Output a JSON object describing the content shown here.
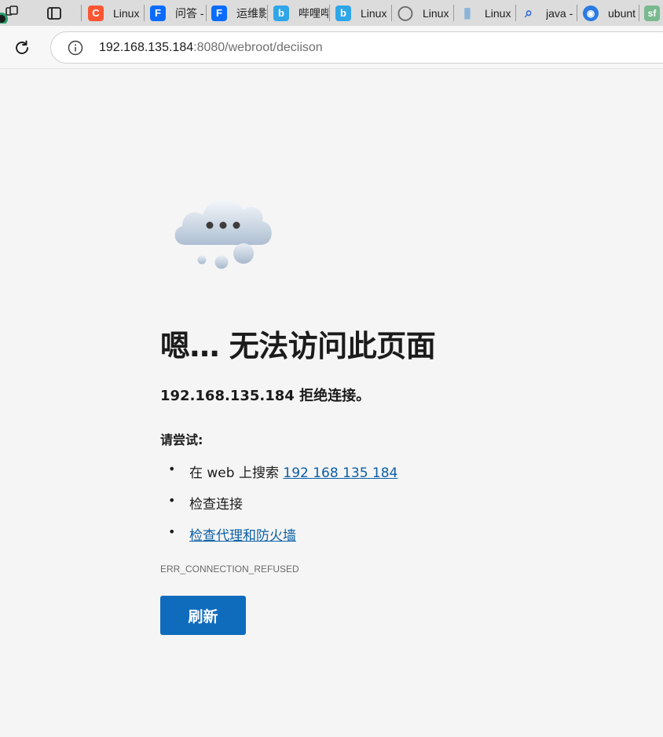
{
  "browser": {
    "tabs": [
      {
        "title": "Linux",
        "icon": "csdn-icon",
        "color": "#fc5531",
        "glyph": "C"
      },
      {
        "title": "问答 -",
        "icon": "tencent-cloud-icon",
        "color": "#0a6cff",
        "glyph": "F"
      },
      {
        "title": "运维影",
        "icon": "tencent-cloud-icon",
        "color": "#0a6cff",
        "glyph": "F"
      },
      {
        "title": "哔哩哔",
        "icon": "bilibili-icon",
        "color": "#2fa6e8",
        "glyph": "b"
      },
      {
        "title": "Linux",
        "icon": "bilibili-icon",
        "color": "#2fa6e8",
        "glyph": "b"
      },
      {
        "title": "Linux",
        "icon": "globe-icon",
        "color": "#7a7a7a",
        "glyph": "◯"
      },
      {
        "title": "Linux",
        "icon": "site-icon",
        "color": "#8ab4d8",
        "glyph": "▮"
      },
      {
        "title": "java -",
        "icon": "search-icon",
        "color": "#3b6fd6",
        "glyph": "⌕"
      },
      {
        "title": "ubunt",
        "icon": "ubuntu-icon",
        "color": "#2a7ae2",
        "glyph": "◉"
      },
      {
        "title": "",
        "icon": "segmentfault-icon",
        "color": "#7ab98f",
        "glyph": "sf"
      }
    ],
    "address": {
      "host": "192.168.135.184",
      "path": ":8080/webroot/deciison"
    }
  },
  "error_page": {
    "heading": "嗯… 无法访问此页面",
    "subheading": "192.168.135.184 拒绝连接。",
    "try_label": "请尝试:",
    "suggestions": {
      "search_prefix": "在 web 上搜索 ",
      "search_link": "192 168 135 184",
      "check_connection": "检查连接",
      "check_proxy": "检查代理和防火墙"
    },
    "error_code": "ERR_CONNECTION_REFUSED",
    "refresh_label": "刷新"
  },
  "colors": {
    "accent": "#0f6cbd",
    "link": "#0b5fa5",
    "background": "#f5f5f5"
  }
}
